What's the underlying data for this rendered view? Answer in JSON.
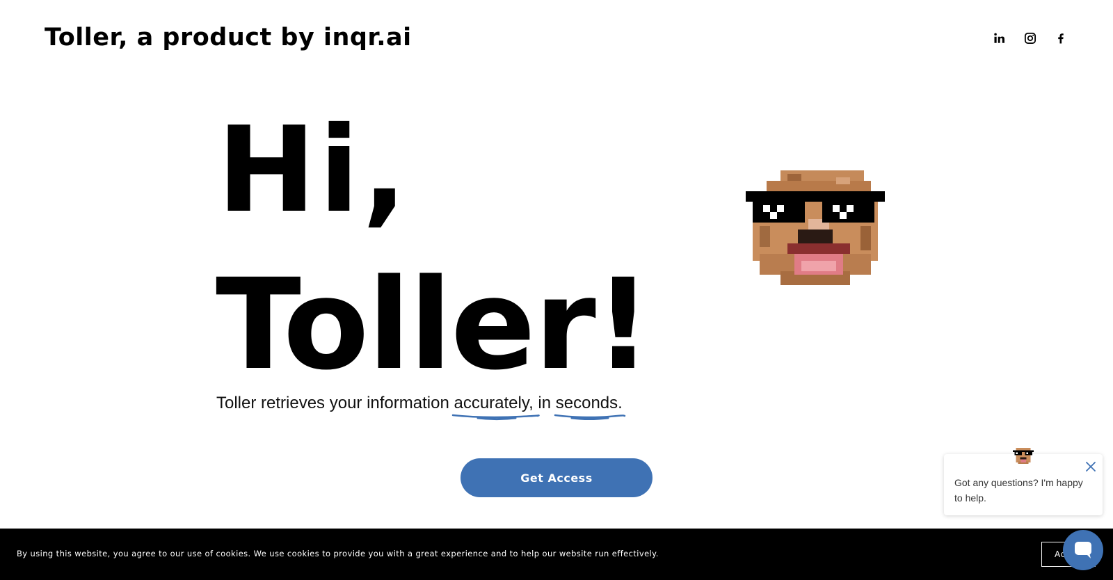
{
  "header": {
    "brand": "Toller, a product by inqr.ai",
    "social_icons": [
      "linkedin-icon",
      "instagram-icon",
      "facebook-icon"
    ]
  },
  "hero": {
    "line1": "Hi,",
    "line2": "Toller!",
    "tagline_start": "Toller retrieves your information ",
    "tagline_emph1": "accurately,",
    "tagline_mid": " in ",
    "tagline_emph2": "seconds.",
    "cta_label": "Get Access"
  },
  "chat": {
    "message": "Got any questions? I'm happy to help."
  },
  "cookie_banner": {
    "text": "By using this website, you agree to our use of cookies. We use cookies to provide you with a great experience and to help our website run effectively.",
    "accept_label": "Ac"
  },
  "colors": {
    "accent": "#3f72b4",
    "text": "#000000",
    "background": "#ffffff",
    "banner": "#000000"
  }
}
